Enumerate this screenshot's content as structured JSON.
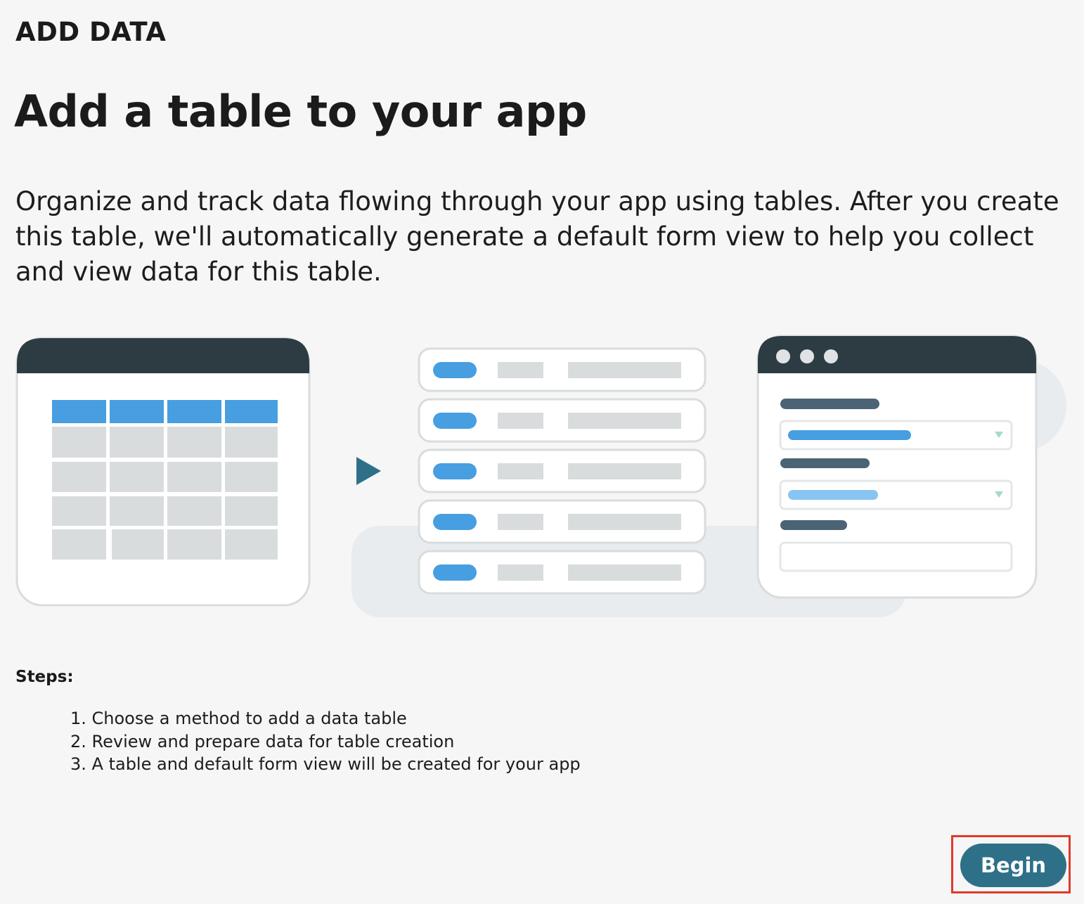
{
  "header": {
    "eyebrow": "ADD DATA",
    "title": "Add a table to your app",
    "description": "Organize and track data flowing through your app using tables. After you create this table, we'll automatically generate a default form view to help you collect and view data for this table."
  },
  "illustration": {
    "icons": [
      "table-grid-icon",
      "play-arrow-icon",
      "record-list-icon",
      "form-window-icon"
    ],
    "colors": {
      "dark_header": "#2d3c43",
      "accent_blue": "#479ee0",
      "light_blue": "#87c4f2",
      "placeholder_gray": "#d9dcdd",
      "arrow_teal": "#2e7088"
    }
  },
  "steps": {
    "label": "Steps:",
    "items": [
      "1. Choose a method to add a data table",
      "2. Review and prepare data for table creation",
      "3. A table and default form view will be created for your app"
    ]
  },
  "actions": {
    "begin_label": "Begin"
  },
  "theme": {
    "background": "#f5f6f5",
    "primary_button": "#2e7088",
    "focus_outline": "#e03a2a"
  }
}
